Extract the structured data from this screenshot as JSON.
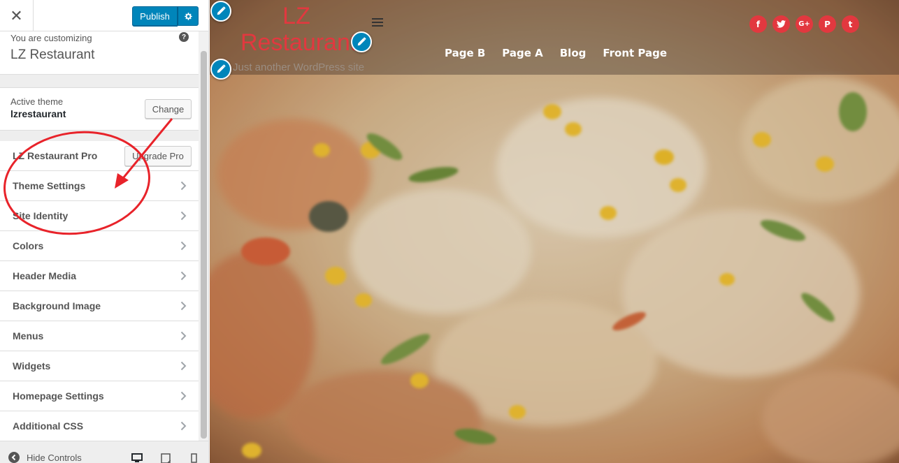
{
  "topbar": {
    "close_icon": "close-icon",
    "publish_label": "Publish",
    "settings_icon": "gear-icon"
  },
  "info": {
    "customizing_label": "You are customizing",
    "site_title": "LZ Restaurant",
    "help_glyph": "?"
  },
  "theme": {
    "active_label": "Active theme",
    "name": "lzrestaurant",
    "change_label": "Change"
  },
  "sections": {
    "pro_label": "LZ Restaurant Pro",
    "upgrade_label": "Upgrade Pro",
    "items": [
      {
        "label": "Theme Settings"
      },
      {
        "label": "Site Identity"
      },
      {
        "label": "Colors"
      },
      {
        "label": "Header Media"
      },
      {
        "label": "Background Image"
      },
      {
        "label": "Menus"
      },
      {
        "label": "Widgets"
      },
      {
        "label": "Homepage Settings"
      },
      {
        "label": "Additional CSS"
      }
    ]
  },
  "footer": {
    "hide_controls_label": "Hide Controls",
    "devices": [
      "desktop-icon",
      "tablet-icon",
      "mobile-icon"
    ]
  },
  "preview": {
    "site_name": "LZ Restaurant",
    "tagline": "Just another WordPress site",
    "nav": [
      "Page B",
      "Page A",
      "Blog",
      "Front Page"
    ],
    "social": [
      {
        "icon": "facebook-icon",
        "glyph": "f"
      },
      {
        "icon": "twitter-icon",
        "glyph": "t"
      },
      {
        "icon": "google-plus-icon",
        "glyph": "G+"
      },
      {
        "icon": "pinterest-icon",
        "glyph": "P"
      },
      {
        "icon": "tumblr-icon",
        "glyph": "t"
      }
    ]
  },
  "colors": {
    "accent": "#0085ba",
    "brand_red": "#e2383f",
    "annotation_red": "#e8232a"
  }
}
